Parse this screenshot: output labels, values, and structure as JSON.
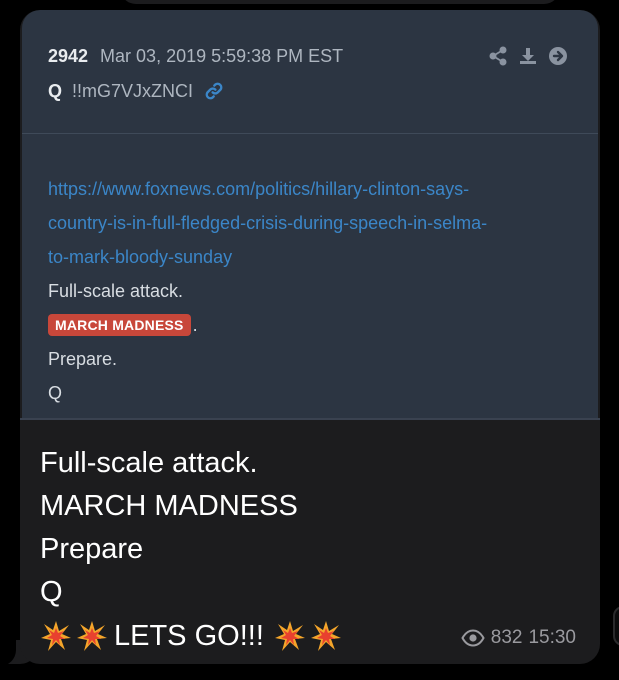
{
  "post": {
    "number": "2942",
    "date": "Mar 03, 2019 5:59:38 PM EST",
    "author": "Q",
    "tripcode": "!!mG7VJxZNCI",
    "link_lines": [
      "https://www.foxnews.com/politics/hillary-clinton-says-",
      "country-is-in-full-fledged-crisis-during-speech-in-selma-",
      "to-mark-bloody-sunday"
    ],
    "line1": "Full-scale attack.",
    "tag": "MARCH MADNESS",
    "tag_suffix": ".",
    "line3": "Prepare.",
    "line4": "Q",
    "actions": [
      "share-icon",
      "download-icon",
      "forward-icon"
    ]
  },
  "caption": {
    "line1": "Full-scale  attack.",
    "line2": "MARCH MADNESS",
    "line3": "Prepare",
    "line4": "Q",
    "final": "LETS GO!!!"
  },
  "footer": {
    "views": "832",
    "time": "15:30"
  },
  "colors": {
    "bubble": "#1c1c1e",
    "card": "#2c3542",
    "link": "#3b86c8",
    "tag": "#c8473a"
  }
}
